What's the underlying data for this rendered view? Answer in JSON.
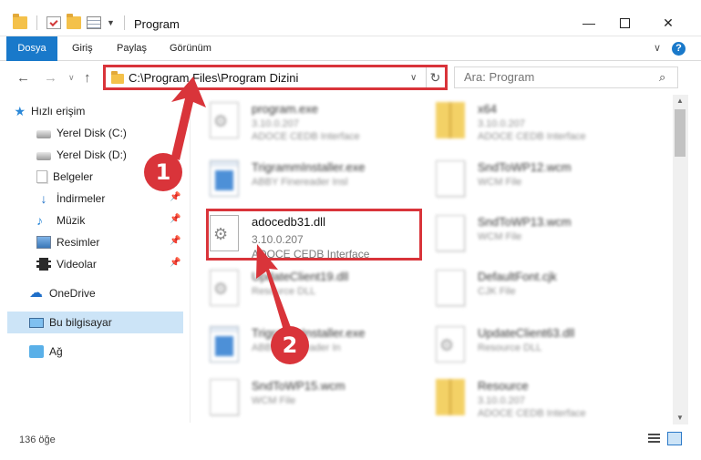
{
  "window": {
    "title": "Program",
    "minimize": "—",
    "close": "✕"
  },
  "ribbon": {
    "tabs": [
      "Dosya",
      "Giriş",
      "Paylaş",
      "Görünüm"
    ],
    "expand": "∨",
    "help": "?"
  },
  "address": {
    "path": "C:\\Program Files\\Program Dizini",
    "refresh": "↻",
    "dropdown": "∨"
  },
  "nav_buttons": {
    "back": "←",
    "forward": "→",
    "recent": "∨",
    "up": "↑"
  },
  "search": {
    "placeholder": "Ara: Program",
    "icon": "⌕"
  },
  "nav_pane": {
    "items": [
      {
        "label": "Hızlı erişim",
        "icon": "star-icon"
      },
      {
        "label": "Yerel Disk (C:)",
        "icon": "disk-icon"
      },
      {
        "label": "Yerel Disk (D:)",
        "icon": "disk-icon"
      },
      {
        "label": "Belgeler",
        "icon": "documents-icon"
      },
      {
        "label": "İndirmeler",
        "icon": "downloads-icon"
      },
      {
        "label": "Müzik",
        "icon": "music-icon"
      },
      {
        "label": "Resimler",
        "icon": "pictures-icon"
      },
      {
        "label": "Videolar",
        "icon": "videos-icon"
      },
      {
        "label": "OneDrive",
        "icon": "cloud-icon"
      },
      {
        "label": "Bu bilgisayar",
        "icon": "computer-icon"
      },
      {
        "label": "Ağ",
        "icon": "network-icon"
      }
    ],
    "pin_glyph": "📌"
  },
  "files": [
    {
      "name": "program.exe",
      "sub1": "3.10.0.207",
      "sub2": "ADOCE CEDB Interface",
      "icon": "settings-file-icon"
    },
    {
      "name": "x64",
      "sub1": "3.10.0.207",
      "sub2": "ADOCE CEDB Interface",
      "icon": "zip-folder-icon"
    },
    {
      "name": "TrigrammInstaller.exe",
      "sub1": "ABBY Finereader Insl",
      "sub2": "",
      "icon": "exe-icon"
    },
    {
      "name": "SndToWP12.wcm",
      "sub1": "WCM File",
      "sub2": "",
      "icon": "document-icon"
    },
    {
      "name": "adocedb31.dll",
      "sub1": "3.10.0.207",
      "sub2": "ADOCE CEDB Interface",
      "icon": "dll-gear-icon"
    },
    {
      "name": "SndToWP13.wcm",
      "sub1": "WCM File",
      "sub2": "",
      "icon": "document-icon"
    },
    {
      "name": "UpdateClient19.dll",
      "sub1": "Resource DLL",
      "sub2": "",
      "icon": "settings-file-icon"
    },
    {
      "name": "DefaultFont.cjk",
      "sub1": "CJK File",
      "sub2": "",
      "icon": "document-icon"
    },
    {
      "name": "TrigrammInstaller.exe",
      "sub1": "ABBY Finereader In",
      "sub2": "",
      "icon": "exe-icon"
    },
    {
      "name": "UpdateClient63.dll",
      "sub1": "Resource DLL",
      "sub2": "",
      "icon": "settings-file-icon"
    },
    {
      "name": "SndToWP15.wcm",
      "sub1": "WCM File",
      "sub2": "",
      "icon": "document-icon"
    },
    {
      "name": "Resource",
      "sub1": "3.10.0.207",
      "sub2": "ADOCE CEDB Interface",
      "icon": "zip-folder-icon"
    }
  ],
  "annotations": {
    "step1": "1",
    "step2": "2",
    "color": "#d9343a"
  },
  "status": {
    "count": "136 öğe"
  },
  "colors": {
    "accent": "#1979ca",
    "selection": "#cce4f7",
    "highlight": "#d9343a"
  }
}
